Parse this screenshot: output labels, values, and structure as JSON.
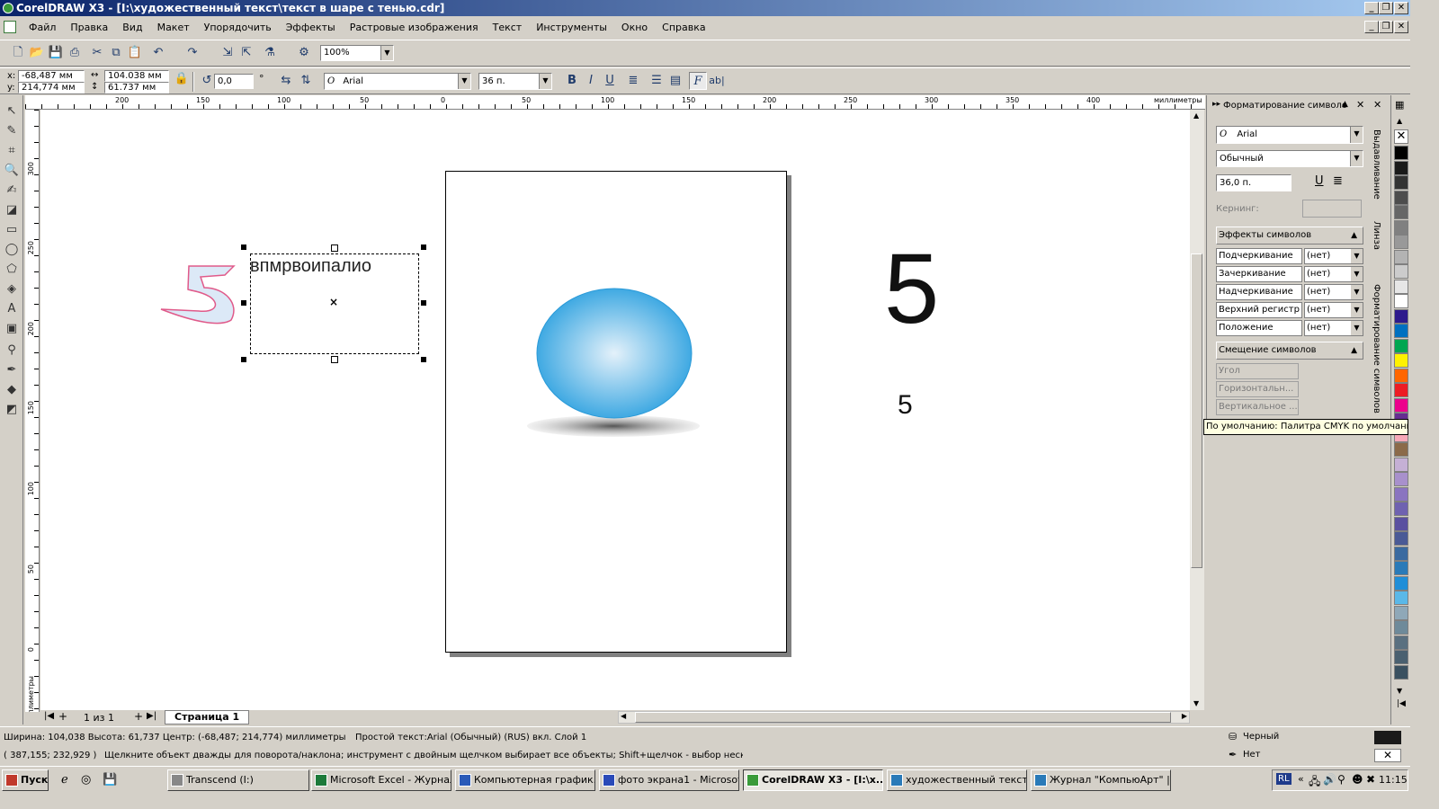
{
  "title": "CorelDRAW X3 - [I:\\художественный текст\\текст в шаре с тенью.cdr]",
  "menu": [
    "Файл",
    "Правка",
    "Вид",
    "Макет",
    "Упорядочить",
    "Эффекты",
    "Растровые изображения",
    "Текст",
    "Инструменты",
    "Окно",
    "Справка"
  ],
  "zoom": "100%",
  "prop": {
    "x": "-68,487 мм",
    "y": "214,774 мм",
    "w": "104.038 мм",
    "h": "61.737 мм",
    "angle": "0,0",
    "font": "Arial",
    "size": "36 п."
  },
  "ruler": {
    "units": "миллиметры",
    "h": [
      "200",
      "150",
      "100",
      "50",
      "0",
      "50",
      "100",
      "150",
      "200",
      "250",
      "300",
      "350",
      "400"
    ],
    "v": [
      "300",
      "250",
      "200",
      "150",
      "100",
      "50",
      "0"
    ]
  },
  "canvas": {
    "text": "впмрвоипалио",
    "big5": "5",
    "small5": "5"
  },
  "pagenav": {
    "count": "1 из 1",
    "tab": "Страница 1"
  },
  "panel": {
    "title": "Форматирование символо",
    "font": "Arial",
    "style": "Обычный",
    "size": "36,0 п.",
    "kerning": "Кернинг:",
    "effects_title": "Эффекты символов",
    "effects": [
      {
        "label": "Подчеркивание",
        "value": "(нет)"
      },
      {
        "label": "Зачеркивание",
        "value": "(нет)"
      },
      {
        "label": "Надчеркивание",
        "value": "(нет)"
      },
      {
        "label": "Верхний регистр",
        "value": "(нет)"
      },
      {
        "label": "Положение",
        "value": "(нет)"
      }
    ],
    "shift_title": "Смещение символов",
    "shift": [
      "Угол",
      "Горизонтальн...",
      "Вертикальное ..."
    ]
  },
  "side_tabs": [
    "Выдавливание",
    "Линза",
    "Форматирование символов"
  ],
  "tooltip": "По умолчанию: Палитра CMYK по умолчанию",
  "palette": [
    "#000000",
    "#1a1a1a",
    "#333333",
    "#4d4d4d",
    "#666666",
    "#808080",
    "#999999",
    "#b3b3b3",
    "#cccccc",
    "#e6e6e6",
    "#ffffff",
    "#2e1a8c",
    "#0070c0",
    "#00a651",
    "#fff200",
    "#ff6600",
    "#ed1c24",
    "#ec008c",
    "#662d91",
    "#f7a8b8",
    "#8b6a4a",
    "#c5b0d5",
    "#a890cc",
    "#8a74c0",
    "#6f62b0",
    "#5a50a0",
    "#4a5a96",
    "#3a6aa0",
    "#2a7ab8",
    "#1f8ed8",
    "#5ab8e8",
    "#8fa8b8",
    "#6e8a9a",
    "#5a7080",
    "#4a6070",
    "#3a5060"
  ],
  "status": {
    "line1": "Ширина: 104,038  Высота: 61,737  Центр: (-68,487; 214,774)  миллиметры",
    "line1b": "Простой текст:Arial (Обычный) (RUS) вкл. Слой 1",
    "line2a": "( 387,155; 232,929 )",
    "line2b": "Щелкните объект дважды для поворота/наклона; инструмент с двойным щелчком выбирает все объекты; Shift+щелчок - выбор нескол...",
    "fill": "Черный",
    "outline": "Нет"
  },
  "taskbar": {
    "start": "Пуск",
    "tasks": [
      "Transcend (I:)",
      "Microsoft Excel - Журнал",
      "Компьютерная график...",
      "фото экрана1 - Microsof...",
      "CorelDRAW X3 - [I:\\х...",
      "художественный текст...",
      "Журнал \"КомпьюАрт\" | ..."
    ],
    "lang": "RL",
    "time": "11:15"
  }
}
